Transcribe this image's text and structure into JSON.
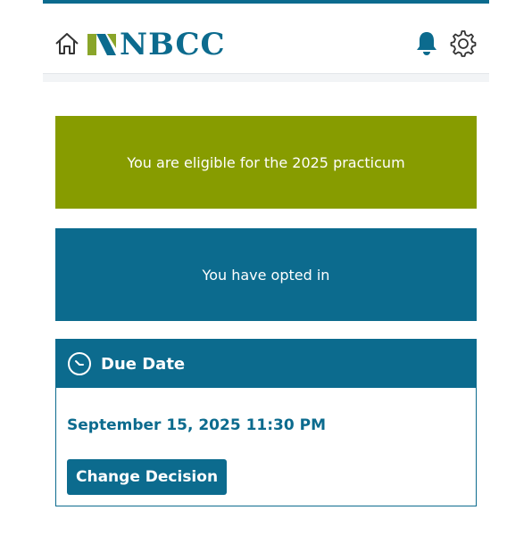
{
  "header": {
    "logo_text": "NBCC",
    "icons": [
      "home-icon",
      "logo-mark-icon",
      "bell-icon",
      "gear-icon"
    ]
  },
  "banners": {
    "eligibility": "You are eligible for the 2025 practicum",
    "optin": "You have opted in"
  },
  "due_card": {
    "title": "Due Date",
    "date": "September 15, 2025 11:30 PM",
    "button_label": "Change Decision"
  },
  "colors": {
    "brand": "#0c6b8e",
    "olive": "#879c00",
    "logo_green": "#8aa52a",
    "background": "#ffffff"
  }
}
